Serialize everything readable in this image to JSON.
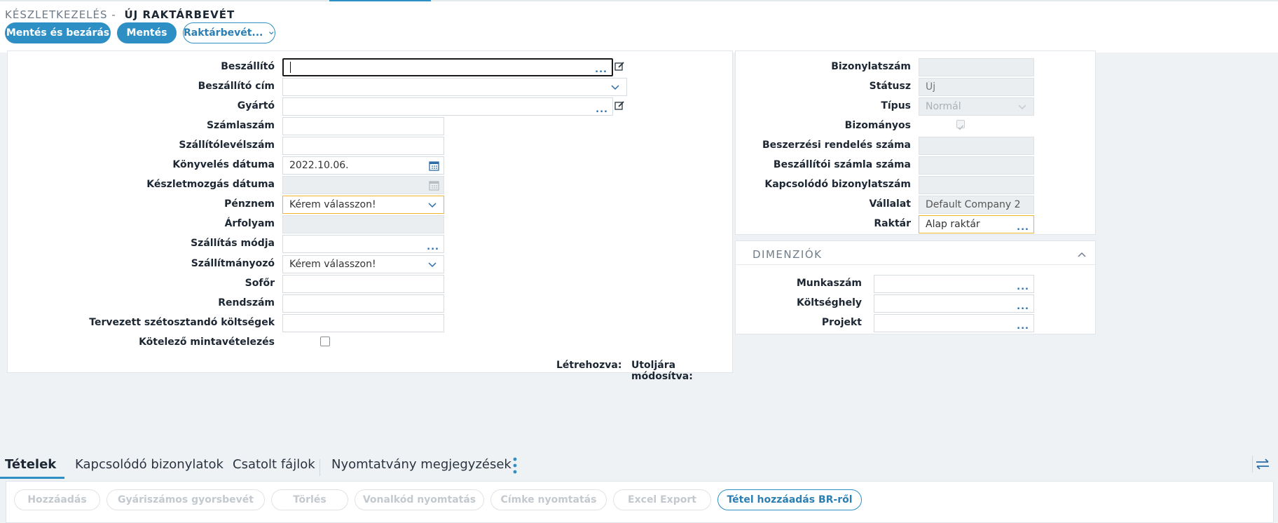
{
  "breadcrumb": {
    "module": "KÉSZLETKEZELÉS -",
    "title": "ÚJ RAKTÁRBEVÉT"
  },
  "actions": {
    "save_close": "Mentés és bezárás",
    "save": "Mentés",
    "more": "Raktárbevét..."
  },
  "form_left": {
    "supplier": {
      "label": "Beszállító",
      "value": ""
    },
    "supplier_address": {
      "label": "Beszállító cím",
      "value": ""
    },
    "manufacturer": {
      "label": "Gyártó",
      "value": ""
    },
    "invoice_no": {
      "label": "Számlaszám",
      "value": ""
    },
    "delivery_note_no": {
      "label": "Szállítólevélszám",
      "value": ""
    },
    "posting_date": {
      "label": "Könyvelés dátuma",
      "value": "2022.10.06."
    },
    "movement_date": {
      "label": "Készletmozgás dátuma",
      "value": ""
    },
    "currency": {
      "label": "Pénznem",
      "value": "Kérem válasszon!"
    },
    "exchange_rate": {
      "label": "Árfolyam",
      "value": ""
    },
    "shipping_method": {
      "label": "Szállítás módja",
      "value": ""
    },
    "carrier": {
      "label": "Szállítmányozó",
      "value": "Kérem válasszon!"
    },
    "driver": {
      "label": "Sofőr",
      "value": ""
    },
    "plate": {
      "label": "Rendszám",
      "value": ""
    },
    "planned_costs": {
      "label": "Tervezett szétosztandó költségek",
      "value": ""
    },
    "sampling": {
      "label": "Kötelező mintavételezés",
      "checked": false
    },
    "created_label": "Létrehozva:",
    "modified_label": "Utoljára módosítva:"
  },
  "form_right": {
    "doc_no": {
      "label": "Bizonylatszám",
      "value": ""
    },
    "status": {
      "label": "Státusz",
      "value": "Új"
    },
    "type": {
      "label": "Típus",
      "value": "Normál"
    },
    "consignment": {
      "label": "Bizományos",
      "checked": true
    },
    "po_number": {
      "label": "Beszerzési rendelés száma",
      "value": ""
    },
    "supplier_invoice_no": {
      "label": "Beszállítói számla száma",
      "value": ""
    },
    "related_doc_no": {
      "label": "Kapcsolódó bizonylatszám",
      "value": ""
    },
    "company": {
      "label": "Vállalat",
      "value": "Default Company 2"
    },
    "warehouse": {
      "label": "Raktár",
      "value": "Alap raktár"
    }
  },
  "dimensions": {
    "heading": "DIMENZIÓK",
    "job_no": {
      "label": "Munkaszám",
      "value": ""
    },
    "cost_center": {
      "label": "Költséghely",
      "value": ""
    },
    "project": {
      "label": "Projekt",
      "value": ""
    }
  },
  "tabs": [
    "Tételek",
    "Kapcsolódó bizonylatok",
    "Csatolt fájlok",
    "Nyomtatvány megjegyzések"
  ],
  "toolbar": [
    "Hozzáadás",
    "Gyáriszámos gyorsbevét",
    "Törlés",
    "Vonalkód nyomtatás",
    "Címke nyomtatás",
    "Excel Export",
    "Tétel hozzáadás BR-ről"
  ],
  "colors": {
    "accent": "#2e8fc5",
    "required_border": "#f0b429",
    "disabled_bg": "#eaeef1"
  }
}
